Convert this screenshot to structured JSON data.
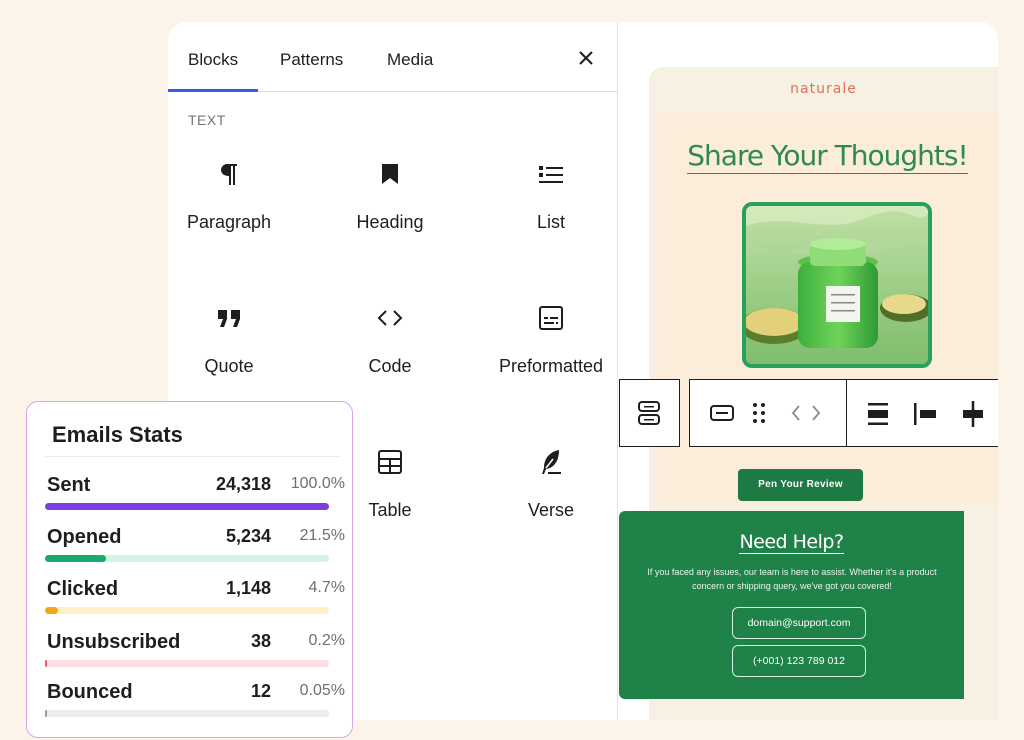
{
  "inserter": {
    "tabs": [
      {
        "label": "Blocks",
        "active": true
      },
      {
        "label": "Patterns",
        "active": false
      },
      {
        "label": "Media",
        "active": false
      }
    ],
    "close_icon": "close-icon",
    "section_label": "TEXT",
    "blocks": [
      {
        "label": "Paragraph",
        "icon": "paragraph-icon"
      },
      {
        "label": "Heading",
        "icon": "bookmark-icon"
      },
      {
        "label": "List",
        "icon": "list-icon"
      },
      {
        "label": "Quote",
        "icon": "quote-icon"
      },
      {
        "label": "Code",
        "icon": "code-icon"
      },
      {
        "label": "Preformatted",
        "icon": "preformatted-icon"
      },
      {
        "label": "Table",
        "icon": "table-icon"
      },
      {
        "label": "Verse",
        "icon": "feather-icon"
      }
    ]
  },
  "email": {
    "brand": "naturale",
    "hero_title": "Share Your Thoughts!",
    "cta_label": "Pen Your Review",
    "help": {
      "title": "Need Help?",
      "text": "If you faced any issues, our team is here to assist. Whether it's a product concern or shipping query, we've got you covered!",
      "email": "domain@support.com",
      "phone": "(+001) 123 789 012"
    }
  },
  "toolbar": {
    "icons": [
      "stack-icon",
      "button-block-icon",
      "drag-handle-icon",
      "move-arrows-icon",
      "align-center-icon",
      "align-left-icon",
      "vertical-align-icon"
    ]
  },
  "stats": {
    "title": "Emails Stats",
    "rows": [
      {
        "name": "Sent",
        "count": "24,318",
        "pct": "100.0%",
        "fraction": 1.0,
        "color": "#7b3fe4",
        "track": "#ece4fb"
      },
      {
        "name": "Opened",
        "count": "5,234",
        "pct": "21.5%",
        "fraction": 0.215,
        "color": "#1aaa6e",
        "track": "#d3f3e4"
      },
      {
        "name": "Clicked",
        "count": "1,148",
        "pct": "4.7%",
        "fraction": 0.047,
        "color": "#f2a81d",
        "track": "#fdf0c8"
      },
      {
        "name": "Unsubscribed",
        "count": "38",
        "pct": "0.2%",
        "fraction": 0.002,
        "color": "#ef5a6f",
        "track": "#fbdde2"
      },
      {
        "name": "Bounced",
        "count": "12",
        "pct": "0.05%",
        "fraction": 0.0005,
        "color": "#9a9a9a",
        "track": "#ececef"
      }
    ]
  }
}
